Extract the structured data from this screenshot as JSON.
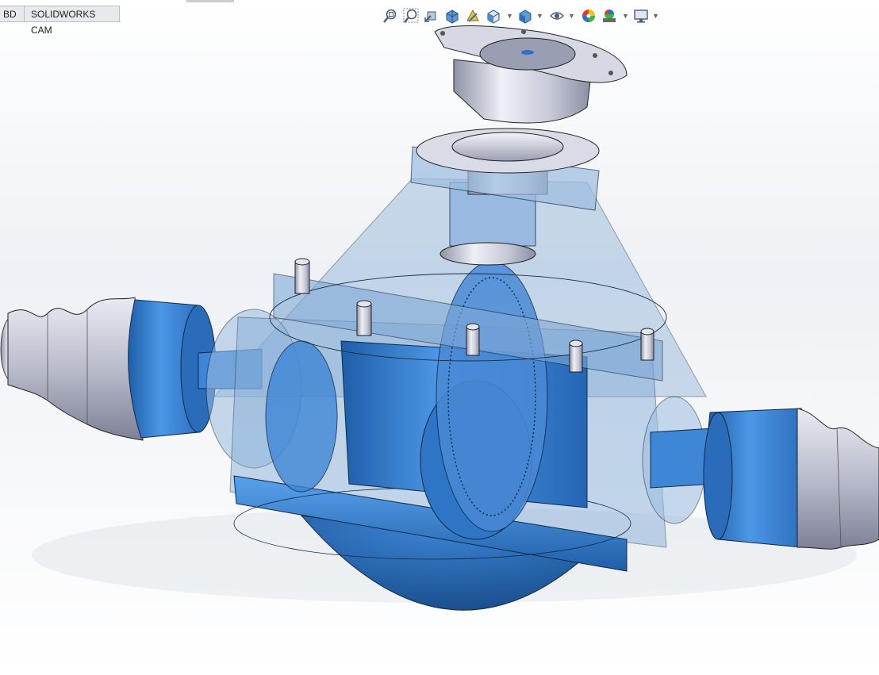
{
  "tabs": [
    {
      "label": "BD"
    },
    {
      "label": "SOLIDWORKS CAM"
    }
  ],
  "heads_up_toolbar": [
    {
      "icon": "zoom-to-fit-icon"
    },
    {
      "icon": "zoom-to-area-icon"
    },
    {
      "icon": "previous-view-icon"
    },
    {
      "icon": "section-view-icon"
    },
    {
      "icon": "dynamic-annotation-views-icon"
    },
    {
      "icon": "view-orientation-icon",
      "dropdown": true
    },
    {
      "icon": "display-style-icon",
      "dropdown": true
    },
    {
      "icon": "hide-show-items-icon",
      "dropdown": true
    },
    {
      "icon": "edit-appearance-icon"
    },
    {
      "icon": "apply-scene-icon",
      "dropdown": true
    },
    {
      "icon": "view-settings-icon",
      "dropdown": true
    }
  ],
  "colors": {
    "part_blue": "#3f86d6",
    "part_blue_dark": "#1f5ea8",
    "transparent_housing": "#8fb3d8",
    "steel": "#c9ccd8",
    "boot_gray": "#b9bccb"
  }
}
